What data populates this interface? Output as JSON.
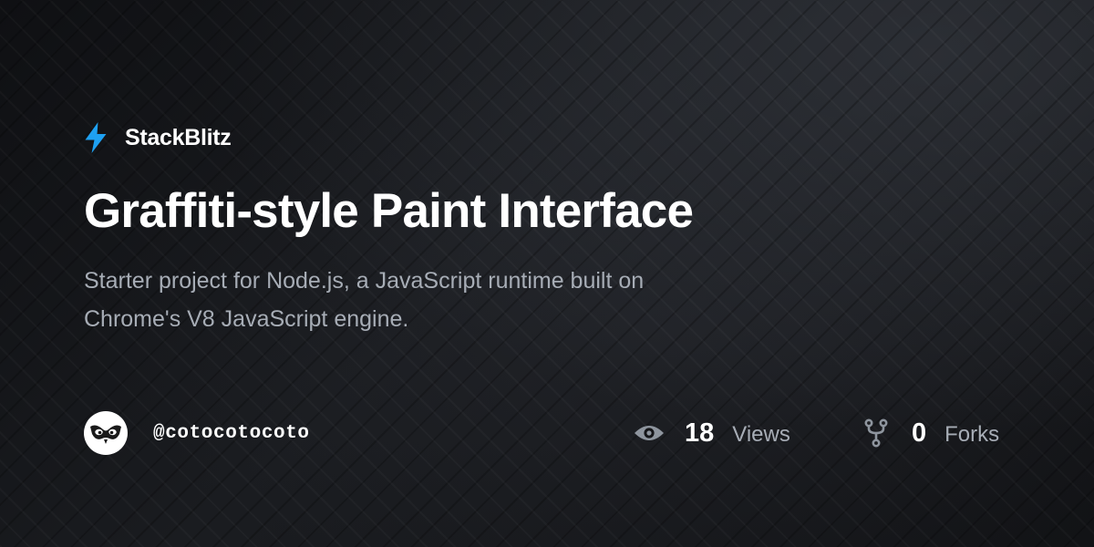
{
  "brand": {
    "name": "StackBlitz",
    "icon": "lightning-bolt-icon",
    "accent_color": "#1ea1f2"
  },
  "project": {
    "title": "Graffiti-style Paint Interface",
    "description": "Starter project for Node.js, a JavaScript runtime built on Chrome's V8 JavaScript engine."
  },
  "author": {
    "username": "@cotocotocoto",
    "avatar_icon": "owl-face-avatar"
  },
  "stats": {
    "views": {
      "count": "18",
      "label": "Views",
      "icon": "eye-icon"
    },
    "forks": {
      "count": "0",
      "label": "Forks",
      "icon": "fork-icon"
    }
  },
  "colors": {
    "background": "#141518",
    "text_primary": "#ffffff",
    "text_secondary": "#a7adb6",
    "icon_muted": "#8e959e"
  }
}
